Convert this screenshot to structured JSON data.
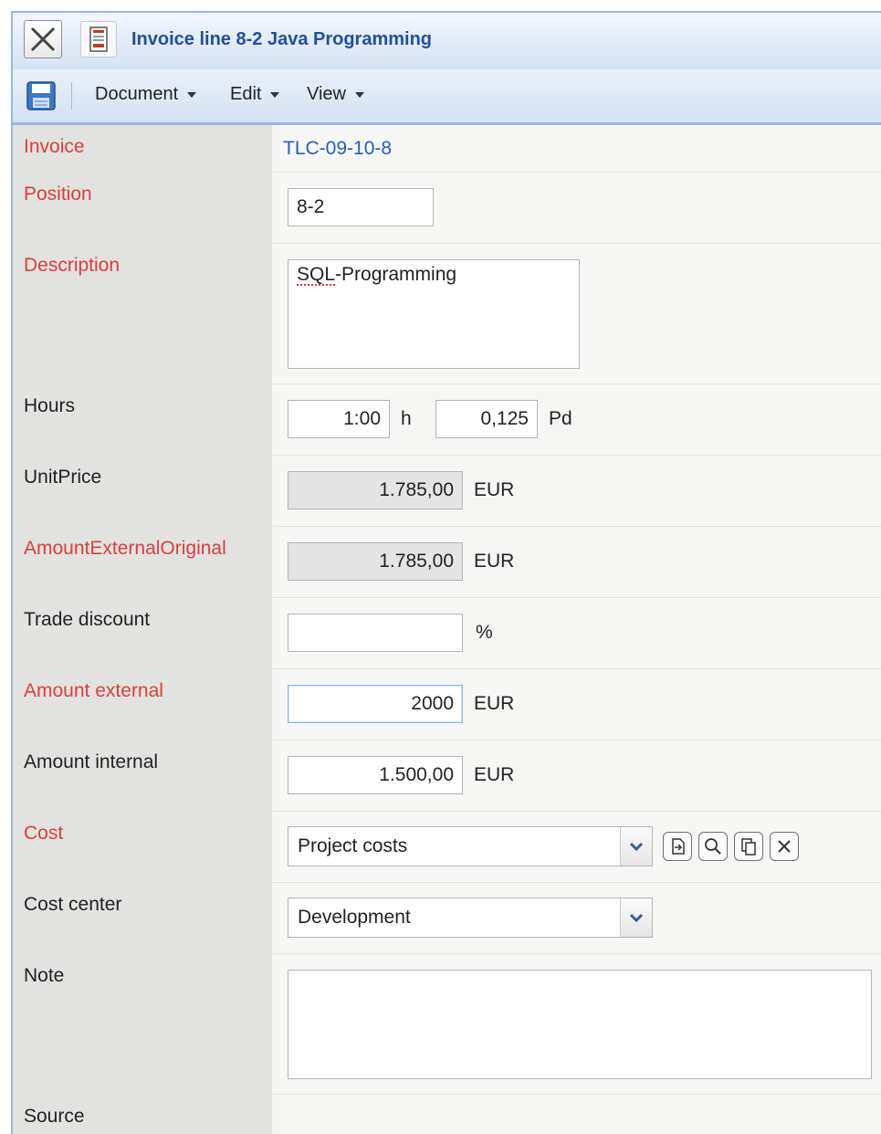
{
  "window": {
    "title": "Invoice line 8-2 Java Programming",
    "close_icon": "close-x-icon",
    "document_icon": "document-icon"
  },
  "toolbar": {
    "save_icon": "floppy-disk-icon",
    "menus": {
      "document": "Document",
      "edit": "Edit",
      "view": "View"
    }
  },
  "form": {
    "invoice": {
      "label": "Invoice",
      "value": "TLC-09-10-8",
      "required": true
    },
    "position": {
      "label": "Position",
      "value": "8-2",
      "required": true
    },
    "description": {
      "label": "Description",
      "value_underlined": "SQL",
      "value_rest": "-Programming",
      "required": true
    },
    "hours": {
      "label": "Hours",
      "hours_value": "1:00",
      "hours_unit": "h",
      "pd_value": "0,125",
      "pd_unit": "Pd"
    },
    "unit_price": {
      "label": "UnitPrice",
      "value": "1.785,00",
      "currency": "EUR"
    },
    "amount_external_original": {
      "label": "AmountExternalOriginal",
      "value": "1.785,00",
      "currency": "EUR",
      "required": true
    },
    "trade_discount": {
      "label": "Trade discount",
      "value": "",
      "unit": "%"
    },
    "amount_external": {
      "label": "Amount external",
      "value": "2000",
      "currency": "EUR",
      "required": true
    },
    "amount_internal": {
      "label": "Amount internal",
      "value": "1.500,00",
      "currency": "EUR"
    },
    "cost": {
      "label": "Cost",
      "value": "Project costs",
      "required": true,
      "actions": [
        "open-record-icon",
        "search-icon",
        "copy-icon",
        "clear-icon"
      ]
    },
    "cost_center": {
      "label": "Cost center",
      "value": "Development"
    },
    "note": {
      "label": "Note",
      "value": ""
    },
    "source": {
      "label": "Source"
    }
  },
  "colors": {
    "required_label": "#d8403a",
    "link": "#2b5bb8",
    "title": "#1f4f9c",
    "label_bg": "#e2e2e0",
    "value_bg": "#f6f6f4"
  }
}
